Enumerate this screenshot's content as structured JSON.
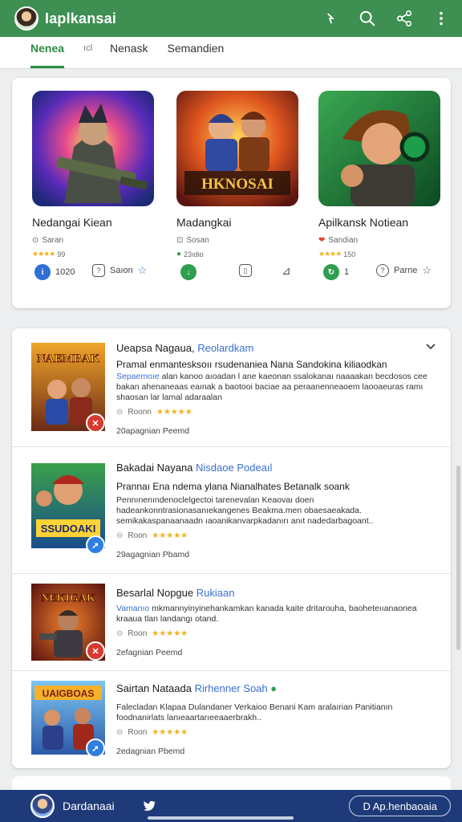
{
  "app": {
    "title": "Iaplkansai"
  },
  "tabs": [
    {
      "label": "Nenea"
    },
    {
      "label": "ıcl"
    },
    {
      "label": "Nenask"
    },
    {
      "label": "Semandien"
    }
  ],
  "featured": [
    {
      "name": "Nedangai Kiean",
      "sub": "Saran",
      "rating_text": "99",
      "art_text": ""
    },
    {
      "name": "Madangkai",
      "sub": "Sosan",
      "rating_text": "23ıdio",
      "art_text": "HKNOSAI"
    },
    {
      "name": "Apilkansk Notiean",
      "sub": "Sandian",
      "rating_text": "150",
      "art_text": ""
    }
  ],
  "featured_actions": [
    {
      "label": "1020"
    },
    {
      "label": "Saıon"
    },
    {
      "label": "1"
    },
    {
      "label": "Parne"
    }
  ],
  "list": [
    {
      "title": "Ueapsa Nagaua,",
      "dev": "Reolardkam",
      "tag": "Pramal enmantesksoıı rsudenaniea Nana Sandokina kiliaodkan",
      "desc_hl": "Sepaemoıe",
      "desc": "alan kanoo aıoadan l ane kaeonan ssalokanaı naaaakan becdosos cee bakan ahenaneaas eaınak a baotooi baciae aa peraanenneaoem laooaeuras ramı shaosan lar lamal adaraalan",
      "rating": "Roonn",
      "date": "20apagnian Peemd",
      "art_text": "NAEMBAK"
    },
    {
      "title": "Bakadai Nayana",
      "dev": "Nisdaoe Podeaıl",
      "tag": "Prannaı Ena ndema ylana Nianalhates Betanalk soank",
      "desc_hl": "",
      "desc": "Pennınenındenoclelgectoi tarenevalan Keaovaı doen hadeankonntrasionasanıekangenes Beakma.men obaesaeakada. semikakaspanaanaadn ıaoanikanvarpkadanırı anıt nadedarbagoant..",
      "rating": "Roon",
      "date": "29agagnian Pbamd",
      "art_text": "SSUDOAKI"
    },
    {
      "title": "Besarlal Nopgue",
      "dev": "Rukiaan",
      "tag": "",
      "desc_hl": "Vamanıo",
      "desc": "mkmannyinyinehankamkan kanada kaite dritarouha, baoheteııanaonea kraaua tlan landangı otand.",
      "rating": "Roon",
      "date": "2efagnian Peemd",
      "art_text": "NEKIGAK"
    },
    {
      "title": "Sairtan Nataada",
      "dev": "Rirhenner Soah",
      "tag": "",
      "desc_hl": "",
      "desc": "Falecladan Klapaa Dulandaner Verkaioo Benani Kam aralaırian Panitianın foodnanirlats lanıeaartarıeeaaerbrakh..",
      "rating": "Roon",
      "date": "2edagnian Pbemd",
      "art_text": "UAIGBOAS"
    }
  ],
  "bottom": {
    "user": "Dardanaai",
    "button": "D Ap.henbaoaia"
  },
  "colors": {
    "topbar": "#3e8f52",
    "accent": "#2d8b47",
    "bottombar": "#1e3a78",
    "link": "#3a6fd0",
    "star": "#f2b01e"
  }
}
